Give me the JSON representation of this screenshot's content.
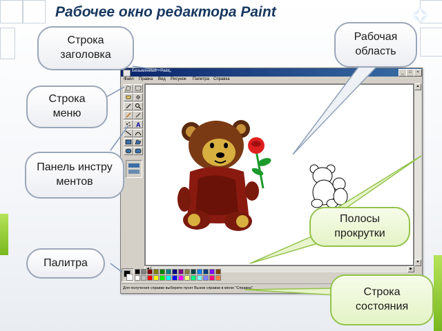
{
  "slide": {
    "title": "Рабочее окно редактора Paint"
  },
  "paint_window": {
    "title_text": "Безымянный - Paint",
    "menu": [
      "Файл",
      "Правка",
      "Вид",
      "Рисунок",
      "Палитра",
      "Справка"
    ],
    "status_text": "Для получения справки выберите пункт Вызов справки в меню \"Справка\".",
    "tools": [
      "free-select",
      "select",
      "eraser",
      "fill",
      "color-picker",
      "magnifier",
      "pencil",
      "brush",
      "airbrush",
      "text",
      "line",
      "curve",
      "rectangle",
      "polygon",
      "ellipse",
      "rounded-rectangle"
    ],
    "palette_colors": [
      "#000000",
      "#808080",
      "#800000",
      "#808000",
      "#008000",
      "#008080",
      "#000080",
      "#800080",
      "#808040",
      "#004040",
      "#0080ff",
      "#004080",
      "#8000ff",
      "#804000",
      "#ffffff",
      "#c0c0c0",
      "#ff0000",
      "#ffff00",
      "#00ff00",
      "#00ffff",
      "#0000ff",
      "#ff00ff",
      "#ffff80",
      "#00ff80",
      "#80ffff",
      "#8080ff",
      "#ff0080",
      "#ff8040"
    ]
  },
  "callouts": {
    "title_bar": "Строка заголовка",
    "work_area": "Рабочая область",
    "menu_bar": "Строка меню",
    "toolbox": "Панель инструментов",
    "scrollbars": "Полосы прокрутки",
    "palette": "Палитра",
    "status_bar": "Строка состояния"
  }
}
